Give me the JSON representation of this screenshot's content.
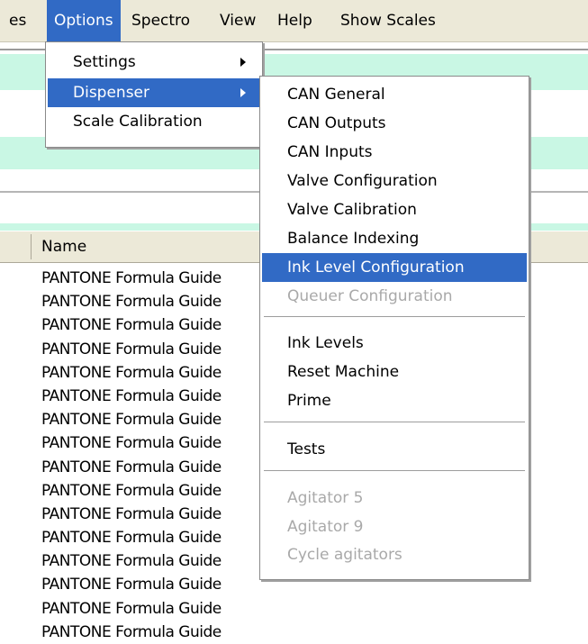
{
  "menubar": {
    "items": [
      "es",
      "Options",
      "Spectro",
      "View",
      "Help",
      "Show Scales"
    ],
    "active": "Options"
  },
  "options_menu": {
    "items": [
      {
        "label": "Settings",
        "submenu": true
      },
      {
        "label": "Dispenser",
        "submenu": true,
        "highlighted": true
      },
      {
        "label": "Scale Calibration",
        "submenu": false
      }
    ]
  },
  "dispenser_menu": {
    "groups": [
      [
        {
          "label": "CAN General"
        },
        {
          "label": "CAN Outputs"
        },
        {
          "label": "CAN Inputs"
        },
        {
          "label": "Valve Configuration"
        },
        {
          "label": "Valve Calibration"
        },
        {
          "label": "Balance Indexing"
        },
        {
          "label": "Ink Level Configuration",
          "highlighted": true
        },
        {
          "label": "Queuer Configuration",
          "disabled": true
        }
      ],
      [
        {
          "label": "Ink Levels"
        },
        {
          "label": "Reset Machine"
        },
        {
          "label": "Prime"
        }
      ],
      [
        {
          "label": "Tests"
        }
      ],
      [
        {
          "label": "Agitator 5",
          "disabled": true
        },
        {
          "label": "Agitator 9",
          "disabled": true
        },
        {
          "label": "Cycle agitators",
          "disabled": true
        }
      ]
    ]
  },
  "table": {
    "column_header": "Name",
    "rows": [
      "PANTONE Formula Guide",
      "PANTONE Formula Guide",
      "PANTONE Formula Guide",
      "PANTONE Formula Guide",
      "PANTONE Formula Guide",
      "PANTONE Formula Guide",
      "PANTONE Formula Guide",
      "PANTONE Formula Guide",
      "PANTONE Formula Guide",
      "PANTONE Formula Guide",
      "PANTONE Formula Guide",
      "PANTONE Formula Guide",
      "PANTONE Formula Guide",
      "PANTONE Formula Guide",
      "PANTONE Formula Guide",
      "PANTONE Formula Guide"
    ]
  },
  "colors": {
    "highlight": "#316ac5",
    "menubar": "#ece9d8",
    "panel_mint": "#c9f7e4",
    "disabled_text": "#a9a9a9"
  }
}
